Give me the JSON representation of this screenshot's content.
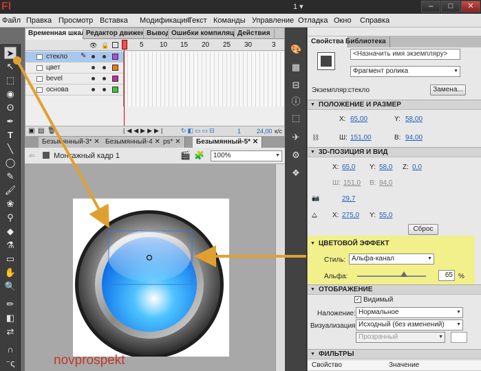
{
  "app": {
    "logo": "Fl",
    "workspace": "1",
    "minimize": "–",
    "restore": "□",
    "close": "✕"
  },
  "menu": [
    "Файл",
    "Правка",
    "Просмотр",
    "Вставка",
    "Модификация",
    "Текст",
    "Команды",
    "Управление",
    "Отладка",
    "Окно",
    "Справка"
  ],
  "timeline": {
    "tabs": [
      "Временная шкала",
      "Редактор движения",
      "Вывод",
      "Ошибки компиляции",
      "Действия"
    ],
    "frame_numbers": [
      "1",
      "5",
      "10",
      "15",
      "20",
      "25",
      "30",
      "3"
    ],
    "layers": [
      {
        "name": "стекло",
        "color": "#b44ae0",
        "selected": true
      },
      {
        "name": "цвет",
        "color": "#e87a1a",
        "selected": false
      },
      {
        "name": "bevel",
        "color": "#c02aa8",
        "selected": false
      },
      {
        "name": "основа",
        "color": "#3ac43a",
        "selected": false
      }
    ],
    "footer": {
      "current_frame": "1",
      "fps": "24,00",
      "fps_unit": "к/с"
    }
  },
  "documents": {
    "tabs": [
      "Безымянный-3*",
      "Безымянный-4",
      "ps*",
      "Безымянный-5*"
    ]
  },
  "editbar": {
    "scene": "Монтажный кадр 1",
    "zoom": "100%"
  },
  "watermark": "novprospekt",
  "properties": {
    "tabs": [
      "Свойства",
      "Библиотека"
    ],
    "instance_name_placeholder": "<Назначить имя экземпляру>",
    "symbol_type": "Фрагмент ролика",
    "instance_label": "Экземпляр:",
    "instance_value": "стекло",
    "swap_button": "Замена...",
    "position_section": "ПОЛОЖЕНИЕ И РАЗМЕР",
    "x_label": "X:",
    "x": "65,00",
    "y_label": "Y:",
    "y": "58,00",
    "w_label": "Ш:",
    "w": "151,00",
    "h_label": "В:",
    "h": "94,00",
    "threed_section": "3D-ПОЗИЦИЯ И ВИД",
    "x3d": "65,0",
    "y3d": "58,0",
    "z_label": "Z:",
    "z3d": "0,0",
    "w3d": "151,0",
    "h3d": "94,0",
    "perspective": "29,7",
    "vanish_x": "275,0",
    "vanish_y": "55,0",
    "reset_button": "Сброс",
    "color_section": "ЦВЕТОВОЙ ЭФФЕКТ",
    "style_label": "Стиль:",
    "style_value": "Альфа-канал",
    "alpha_label": "Альфа:",
    "alpha_value": "65",
    "alpha_unit": "%",
    "display_section": "ОТОБРАЖЕНИЕ",
    "visible_label": "Видимый",
    "blend_label": "Наложение:",
    "blend_value": "Нормальное",
    "render_label": "Визуализация:",
    "render_value": "Исходный (без изменений)",
    "transparent_value": "Прозрачный",
    "filters_section": "ФИЛЬТРЫ",
    "filters_col1": "Свойство",
    "filters_col2": "Значение"
  },
  "colors": {
    "highlight": "#f1f08b",
    "arrow": "#e0a030",
    "accent_blue": "#1e90ff"
  }
}
